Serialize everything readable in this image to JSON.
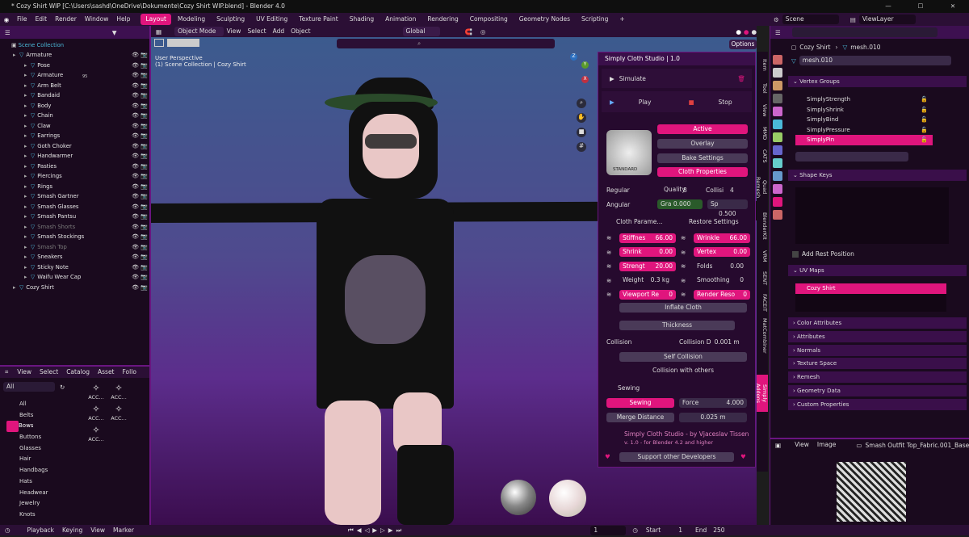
{
  "app": {
    "title": "* Cozy Shirt WIP [C:\\Users\\sashd\\OneDrive\\Dokumente\\Cozy Shirt WIP.blend] - Blender 4.0",
    "accent": "#e0157d",
    "panel_bg": "#260a2e"
  },
  "menu": {
    "items": [
      "File",
      "Edit",
      "Render",
      "Window",
      "Help"
    ]
  },
  "workspaces": [
    "Layout",
    "Modeling",
    "Sculpting",
    "UV Editing",
    "Texture Paint",
    "Shading",
    "Animation",
    "Rendering",
    "Compositing",
    "Geometry Nodes",
    "Scripting"
  ],
  "topright": {
    "scene": "Scene",
    "viewlayer": "ViewLayer"
  },
  "outliner": {
    "collection": "Scene Collection",
    "items": [
      {
        "name": "Armature",
        "indent": 1,
        "dim": false
      },
      {
        "name": "Pose",
        "indent": 2,
        "dim": false
      },
      {
        "name": "Armature",
        "indent": 2,
        "dim": false
      },
      {
        "name": "Arm Belt",
        "indent": 2,
        "dim": false
      },
      {
        "name": "Bandaid",
        "indent": 2,
        "dim": false
      },
      {
        "name": "Body",
        "indent": 2,
        "dim": false
      },
      {
        "name": "Chain",
        "indent": 2,
        "dim": false
      },
      {
        "name": "Claw",
        "indent": 2,
        "dim": false
      },
      {
        "name": "Earrings",
        "indent": 2,
        "dim": false
      },
      {
        "name": "Goth Choker",
        "indent": 2,
        "dim": false
      },
      {
        "name": "Handwarmer",
        "indent": 2,
        "dim": false
      },
      {
        "name": "Pasties",
        "indent": 2,
        "dim": false
      },
      {
        "name": "Piercings",
        "indent": 2,
        "dim": false
      },
      {
        "name": "Rings",
        "indent": 2,
        "dim": false
      },
      {
        "name": "Smash Gartner",
        "indent": 2,
        "dim": false
      },
      {
        "name": "Smash Glasses",
        "indent": 2,
        "dim": false
      },
      {
        "name": "Smash Pantsu",
        "indent": 2,
        "dim": false
      },
      {
        "name": "Smash Shorts",
        "indent": 2,
        "dim": true
      },
      {
        "name": "Smash Stockings",
        "indent": 2,
        "dim": false
      },
      {
        "name": "Smash Top",
        "indent": 2,
        "dim": true
      },
      {
        "name": "Sneakers",
        "indent": 2,
        "dim": false
      },
      {
        "name": "Sticky Note",
        "indent": 2,
        "dim": false
      },
      {
        "name": "Waifu Wear Cap",
        "indent": 2,
        "dim": false
      },
      {
        "name": "Cozy Shirt",
        "indent": 1,
        "dim": false
      }
    ],
    "armature_badge": "95"
  },
  "assets": {
    "menu": [
      "View",
      "Select",
      "Catalog",
      "Asset",
      "Follo"
    ],
    "library": "All",
    "categories": [
      "All",
      "Belts",
      "Bows",
      "Buttons",
      "Glasses",
      "Hair",
      "Handbags",
      "Hats",
      "Headwear",
      "Jewelry",
      "Knots"
    ],
    "selected": "Bows",
    "thumb_labels": [
      "ACC...",
      "ACC...",
      "ACC...",
      "ACC...",
      "ACC..."
    ]
  },
  "viewport": {
    "mode": "Object Mode",
    "menu": [
      "View",
      "Select",
      "Add",
      "Object"
    ],
    "transform": "Global",
    "info1": "User Perspective",
    "info2": "(1) Scene Collection | Cozy Shirt",
    "options": "Options",
    "axis": {
      "x": "X",
      "y": "Y",
      "z": "Z"
    }
  },
  "cloth": {
    "header": "Simply Cloth Studio | 1.0",
    "simulate": "Simulate",
    "play": "Play",
    "stop": "Stop",
    "active": "Active",
    "overlay": "Overlay",
    "bake": "Bake Settings",
    "cloth_props": "Cloth Properties",
    "preset_label": "STANDARD",
    "regular": "Regular",
    "quality_label": "Quality",
    "quality_val": "8",
    "collisi_label": "Collisi",
    "collisi_val": "4",
    "angular": "Angular",
    "gra_label": "Gra",
    "gra_val": "0.000",
    "sp_label": "Sp",
    "sp_val": "0.500",
    "cloth_params": "Cloth Parame...",
    "restore": "Restore Settings",
    "stiffness_label": "Stiffnes",
    "stiffness_val": "66.00",
    "wrinkle_label": "Wrinkle",
    "wrinkle_val": "66.00",
    "shrink_label": "Shrink",
    "shrink_val": "0.00",
    "vertex_label": "Vertex",
    "vertex_val": "0.00",
    "strength_label": "Strengt",
    "strength_val": "20.00",
    "folds_label": "Folds",
    "folds_val": "0.00",
    "weight_label": "Weight",
    "weight_val": "0.3 kg",
    "smoothing_label": "Smoothing",
    "smoothing_val": "0",
    "viewport_label": "Viewport Re",
    "viewport_val": "0",
    "render_label": "Render Reso",
    "render_val": "0",
    "inflate": "Inflate Cloth",
    "thickness": "Thickness",
    "collision": "Collision",
    "collision_d_label": "Collision D",
    "collision_d_val": "0.001 m",
    "self_collision": "Self Collision",
    "collision_others": "Collision with others",
    "sewing_header": "Sewing",
    "sewing": "Sewing",
    "force_label": "Force",
    "force_val": "4.000",
    "merge": "Merge Distance",
    "merge_val": "0.025 m",
    "credit1": "Simply Cloth Studio - by Vjaceslav Tissen",
    "credit2": "v. 1.0 - for Blender 4.2 and higher",
    "support": "Support other Developers"
  },
  "vtabs": [
    "Item",
    "Tool",
    "View",
    "MMD",
    "CATS",
    "Quad Remesh",
    "BlenderKit",
    "VRM",
    "SENT",
    "FACEIT",
    "MatCombiner",
    "Simply Addons"
  ],
  "props": {
    "object": "Cozy Shirt",
    "mesh": "mesh.010",
    "mesh_field": "mesh.010",
    "sections": {
      "vertex_groups": "Vertex Groups",
      "shape_keys": "Shape Keys",
      "add_rest": "Add Rest Position",
      "uv_maps": "UV Maps",
      "color_attributes": "Color Attributes",
      "attributes": "Attributes",
      "normals": "Normals",
      "texture_space": "Texture Space",
      "remesh": "Remesh",
      "geometry_data": "Geometry Data",
      "custom_properties": "Custom Properties"
    },
    "vertex_groups": [
      "SimplyStrength",
      "SimplyShrink",
      "SimplyBind",
      "SimplyPressure",
      "SimplyPin"
    ],
    "vg_selected": "SimplyPin",
    "uv_map": "Cozy Shirt"
  },
  "image_editor": {
    "view": "View",
    "image": "Image",
    "name": "Smash Outfit Top_Fabric.001_BaseColo"
  },
  "timeline": {
    "playback": "Playback",
    "keying": "Keying",
    "view": "View",
    "marker": "Marker",
    "frame": "1",
    "start_label": "Start",
    "start": "1",
    "end_label": "End",
    "end": "250"
  }
}
